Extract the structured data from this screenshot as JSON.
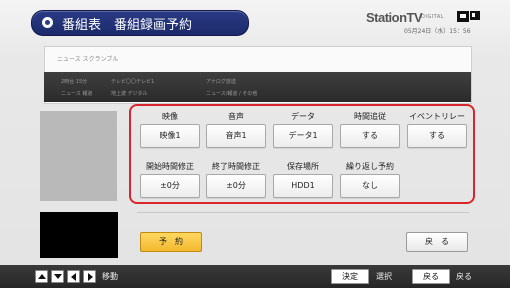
{
  "header": {
    "title": "番組表　番組録画予約",
    "logo": "StationTV",
    "logo_sub": "DIGITAL",
    "datetime": "05月24日（水）15：56"
  },
  "program": {
    "title": "ニュース スクランブル　",
    "info_row1": [
      "2時台 15分",
      "テレビ〇〇テレビ1",
      "アナログ放送"
    ],
    "info_row2": [
      "ニュース 報道",
      "地上波 デジタル",
      "ニュース/報道 / その他"
    ]
  },
  "settings": {
    "labels": {
      "video": "映像",
      "audio": "音声",
      "data": "データ",
      "time_follow": "時間追従",
      "event_relay": "イベントリレー",
      "start_adjust": "開始時間修正",
      "end_adjust": "終了時間修正",
      "save_location": "保存場所",
      "repeat": "繰り返し予約"
    },
    "values": {
      "video": "映像1",
      "audio": "音声1",
      "data": "データ1",
      "time_follow": "する",
      "event_relay": "する",
      "start_adjust": "±0分",
      "end_adjust": "±0分",
      "save_location": "HDD1",
      "repeat": "なし"
    }
  },
  "actions": {
    "reserve": "予　約",
    "back": "戻　る"
  },
  "footer": {
    "move": "移動",
    "decide_key": "決定",
    "decide_text": "選択",
    "back_key": "戻る",
    "back_text": "戻る"
  },
  "colors": {
    "title_bar": "#2a3a84",
    "highlight": "#d7262c",
    "reserve_button": "#f2b830"
  }
}
